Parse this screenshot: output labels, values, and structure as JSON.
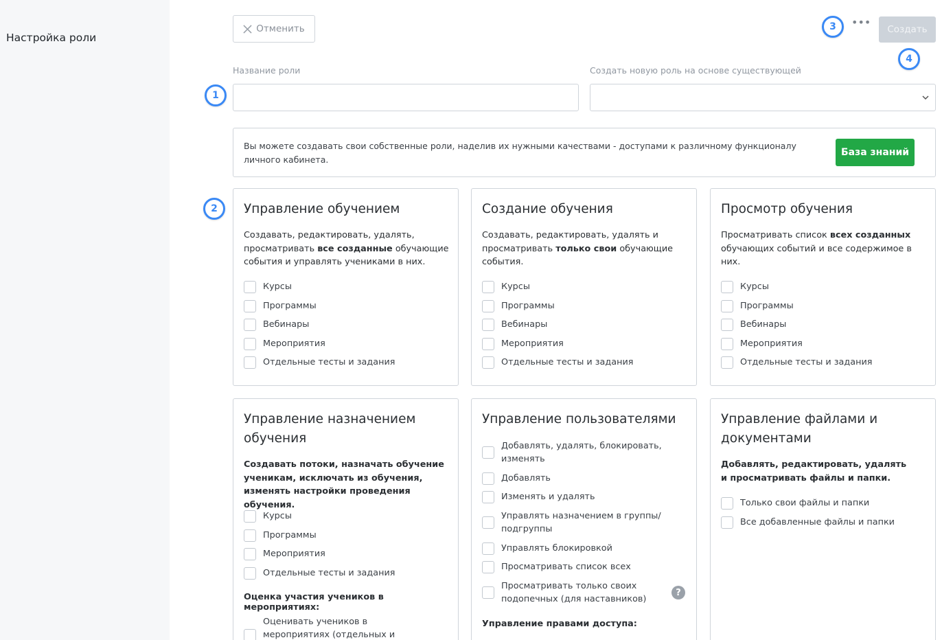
{
  "sidebar": {
    "title": "Настройка роли"
  },
  "toolbar": {
    "cancel_label": "Отменить",
    "more_label": "•••",
    "create_label": "Создать"
  },
  "badges": [
    "1",
    "2",
    "3",
    "4"
  ],
  "form": {
    "role_name_label": "Название роли",
    "role_name_value": "",
    "base_role_label": "Создать новую роль на основе существующей",
    "base_role_value": ""
  },
  "info": {
    "text": "Вы можете создавать свои собственные роли, наделив их нужными качествами - доступами к различному функционалу личного кабинета.",
    "kb_button": "База знаний"
  },
  "cards": [
    {
      "title": "Управление обучением",
      "desc": [
        "Создавать, редактировать, удалять, просматривать ",
        "все созданные",
        " обучающие события и управлять учениками в них."
      ],
      "items": [
        "Курсы",
        "Программы",
        "Вебинары",
        "Мероприятия",
        "Отдельные тесты и задания"
      ]
    },
    {
      "title": "Создание обучения",
      "desc": [
        "Создавать, редактировать, удалять и просматривать ",
        "только свои",
        " обучающие события."
      ],
      "items": [
        "Курсы",
        "Программы",
        "Вебинары",
        "Мероприятия",
        "Отдельные тесты и задания"
      ]
    },
    {
      "title": "Просмотр обучения",
      "desc": [
        "Просматривать список ",
        "всех созданных",
        " обучающих событий и все содержимое в них."
      ],
      "items": [
        "Курсы",
        "Программы",
        "Вебинары",
        "Мероприятия",
        "Отдельные тесты и задания"
      ]
    },
    {
      "title": "Управление назначением обучения",
      "desc": [
        "Создавать потоки, назначать обучение ученикам, исключать из обучения, изменять настройки проведения обучения.",
        "",
        ""
      ],
      "items": [
        "Курсы",
        "Программы",
        "Мероприятия",
        "Отдельные тесты и задания"
      ],
      "sub_head": "Оценка участия учеников в мероприятиях:",
      "sub_items": [
        "Оценивать учеников в мероприятиях (отдельных и запущенных из программ)"
      ]
    },
    {
      "title": "Управление пользователями",
      "items": [
        "Добавлять, удалять, блокировать, изменять",
        "Добавлять",
        "Изменять и удалять",
        "Управлять назначением в группы/подгруппы",
        "Управлять блокировкой",
        "Просматривать список всех",
        "Просматривать только своих подопечных (для наставников)"
      ],
      "help": "?",
      "sub_head": "Управление правами доступа:"
    },
    {
      "title": "Управление файлами и документами",
      "desc": [
        "Добавлять, редактировать, удалять и просматривать файлы и папки.",
        "",
        ""
      ],
      "items": [
        "Только свои файлы и папки",
        "Все добавленные файлы и папки"
      ]
    }
  ],
  "colors": {
    "accent": "#3a89f5",
    "success": "#22a846",
    "disabled": "#cdd3da"
  }
}
